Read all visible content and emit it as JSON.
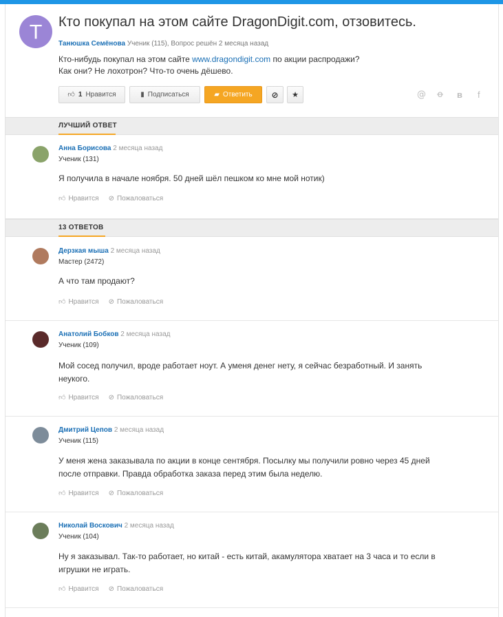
{
  "question": {
    "avatar_letter": "Т",
    "title": "Кто покупал на этом сайте DragonDigit.com, отзовитесь.",
    "author": "Танюшка Семёнова",
    "meta": "Ученик (115), Вопрос решён 2 месяца назад",
    "text_before": "Кто-нибудь покупал на этом сайте ",
    "link": "www.dragondigit.com",
    "text_after": " по акции распродажи?",
    "text_line2": "Как они? Не лохотрон? Что-то очень дёшево.",
    "like_count": "1",
    "like_label": "Нравится",
    "subscribe_label": "Подписаться",
    "answer_label": "Ответить"
  },
  "share_icons": [
    "mail-icon",
    "odnoklassniki-icon",
    "vk-icon",
    "facebook-icon"
  ],
  "best_answer_heading": "ЛУЧШИЙ ОТВЕТ",
  "answers_heading": "13 ОТВЕТОВ",
  "action_labels": {
    "like": "Нравится",
    "report": "Пожаловаться"
  },
  "best_answer": {
    "name": "Анна Борисова",
    "time": "2 месяца назад",
    "rank": "Ученик (131)",
    "text": "Я получила в начале ноября. 50 дней шёл пешком ко мне мой нотик)",
    "avatar_color": "#8aa36a"
  },
  "answers": [
    {
      "name": "Дерзкая мыша",
      "time": "2 месяца назад",
      "rank": "Мастер (2472)",
      "text": "А что там продают?",
      "avatar_color": "#b07a5e"
    },
    {
      "name": "Анатолий Бобков",
      "time": "2 месяца назад",
      "rank": "Ученик (109)",
      "text": "Мой сосед получил, вроде работает ноут. А уменя денег нету, я сейчас безработный. И занять неукого.",
      "avatar_color": "#5a2a2a"
    },
    {
      "name": "Дмитрий Цепов",
      "time": "2 месяца назад",
      "rank": "Ученик (115)",
      "text": "У меня жена заказывала по акции в конце сентября. Посылку мы получили ровно через 45 дней после отправки. Правда обработка заказа перед этим была неделю.",
      "avatar_color": "#7d8c9a"
    },
    {
      "name": "Николай Воскович",
      "time": "2 месяца назад",
      "rank": "Ученик (104)",
      "text": "Ну я заказывал. Так-то работает, но китай - есть китай, акамулятора хватает на 3 часа и то если в игрушки не играть.",
      "avatar_color": "#6b7d5a"
    }
  ]
}
